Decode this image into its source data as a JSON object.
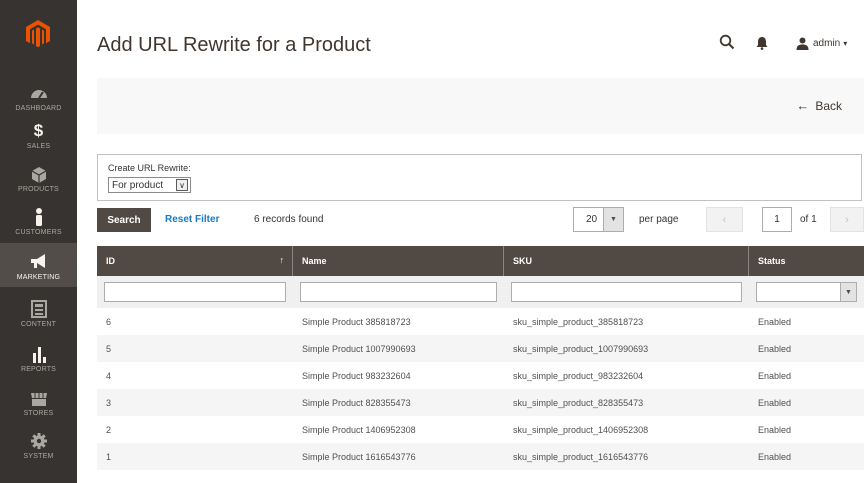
{
  "sidebar": {
    "items": [
      {
        "label": "DASHBOARD",
        "icon": "dashboard-icon",
        "active": false
      },
      {
        "label": "SALES",
        "icon": "dollar-icon",
        "active": false
      },
      {
        "label": "PRODUCTS",
        "icon": "box-icon",
        "active": false
      },
      {
        "label": "CUSTOMERS",
        "icon": "person-icon",
        "active": false
      },
      {
        "label": "MARKETING",
        "icon": "megaphone-icon",
        "active": true
      },
      {
        "label": "CONTENT",
        "icon": "layout-icon",
        "active": false
      },
      {
        "label": "REPORTS",
        "icon": "bar-chart-icon",
        "active": false
      },
      {
        "label": "STORES",
        "icon": "store-icon",
        "active": false
      },
      {
        "label": "SYSTEM",
        "icon": "gear-icon",
        "active": false
      }
    ]
  },
  "header": {
    "title": "Add URL Rewrite for a Product",
    "user": "admin"
  },
  "actions": {
    "back_label": "Back"
  },
  "create": {
    "label": "Create URL Rewrite:",
    "selected": "For product"
  },
  "toolbar": {
    "search_label": "Search",
    "reset_label": "Reset Filter",
    "records": "6 records found",
    "per_page_value": "20",
    "per_page_label": "per page",
    "page_current": "1",
    "page_of": "of 1"
  },
  "grid": {
    "columns": [
      "ID",
      "Name",
      "SKU",
      "Status"
    ],
    "rows": [
      {
        "id": "6",
        "name": "Simple Product 385818723",
        "sku": "sku_simple_product_385818723",
        "status": "Enabled"
      },
      {
        "id": "5",
        "name": "Simple Product 1007990693",
        "sku": "sku_simple_product_1007990693",
        "status": "Enabled"
      },
      {
        "id": "4",
        "name": "Simple Product 983232604",
        "sku": "sku_simple_product_983232604",
        "status": "Enabled"
      },
      {
        "id": "3",
        "name": "Simple Product 828355473",
        "sku": "sku_simple_product_828355473",
        "status": "Enabled"
      },
      {
        "id": "2",
        "name": "Simple Product 1406952308",
        "sku": "sku_simple_product_1406952308",
        "status": "Enabled"
      },
      {
        "id": "1",
        "name": "Simple Product 1616543776",
        "sku": "sku_simple_product_1616543776",
        "status": "Enabled"
      }
    ]
  },
  "colors": {
    "sidebar_bg": "#373330",
    "accent": "#eb5202",
    "grid_header": "#514943",
    "link": "#1979c3"
  }
}
